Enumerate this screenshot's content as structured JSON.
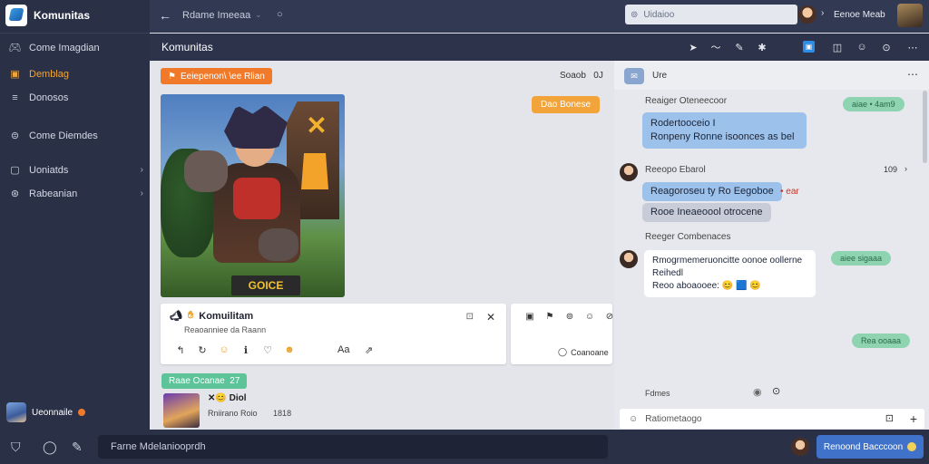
{
  "app": {
    "name": "Komunitas"
  },
  "sidebar": {
    "items": [
      {
        "label": "Come Imagdian",
        "icon": "gamepad-icon"
      },
      {
        "label": "Demblag",
        "icon": "folder-icon",
        "active": true
      },
      {
        "label": "Donosos",
        "icon": "menu-icon"
      },
      {
        "label": "Come Diemdes",
        "icon": "gamepad-icon"
      },
      {
        "label": "Uoniatds",
        "icon": "chat-icon",
        "chevron": true
      },
      {
        "label": "Rabeanian",
        "icon": "gamepad-icon",
        "chevron": true
      }
    ],
    "user": {
      "name": "Ueonnaile"
    }
  },
  "topbar": {
    "title": "Rdame Imeeaa",
    "search_placeholder": "Uidaioo",
    "user_name": "Eenoe Meab"
  },
  "channel_bar": {
    "title": "Komunitas"
  },
  "main": {
    "post_tag": "Eeiepenon\\ \\ee Rlian",
    "post_meta": "Soaob",
    "post_count": "0J",
    "orange_pill": "Dao Bonese",
    "hero_badge": "GOICE",
    "card": {
      "title": "Komuilitam",
      "subtitle": "Reaoanniee da Raann",
      "share": "Aa"
    },
    "card2_option": "Coanoane",
    "green_pill": "Raae Ocanae",
    "green_pill_num": "27",
    "mini_title": "Diol",
    "mini_sub": "Rniirano Roio",
    "mini_time": "1818"
  },
  "chat": {
    "header": "Ure",
    "messages": [
      {
        "name": "Reaiger Oteneecoor",
        "pill": "aiae • 4am9",
        "lines": [
          "Rodertooceio I",
          "Ronpeny Ronne isoonces as bel"
        ]
      },
      {
        "name": "Reeopo Ebarol",
        "time": "109",
        "lines": [
          "Reagoroseu ty Ro Eegoboe",
          "Rooe Ineaeoool otrocene"
        ],
        "tag": "• ear"
      },
      {
        "name": "Reeger Combenaces",
        "pill": "aiee sigaaa",
        "lines": [
          "Rmogrmemeruoncitte oonoe oollerne",
          "Reihedl",
          "Reoo aboaooee: 😊 🟦 😊"
        ]
      },
      {
        "pill": "Rea ooaaa"
      }
    ],
    "footer_label": "Fdmes",
    "input_placeholder": "Ratiometaogo"
  },
  "bottom": {
    "input_placeholder": "Farne Mdelaniooprdh",
    "button_label": "Renoond Bacccoon"
  }
}
